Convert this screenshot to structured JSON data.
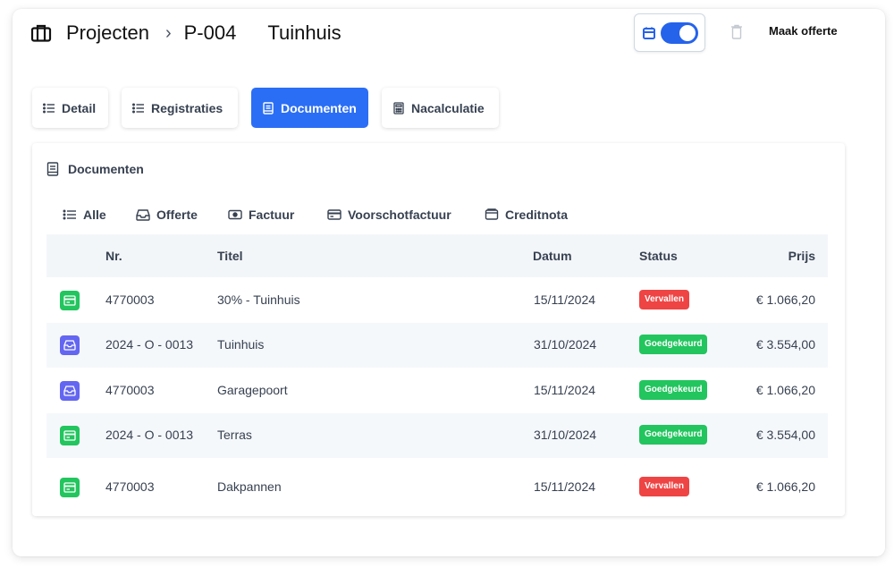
{
  "header": {
    "breadcrumb": "Projecten",
    "project_number": "P-004",
    "project_title": "Tuinhuis"
  },
  "actions": {
    "toggle_on": true,
    "make_quote_label": "Maak offerte"
  },
  "tabs": [
    {
      "label": "Detail",
      "icon": "list-icon",
      "active": false
    },
    {
      "label": "Registraties",
      "icon": "list-icon",
      "active": false
    },
    {
      "label": "Documenten",
      "icon": "document-icon",
      "active": true
    },
    {
      "label": "Nacalculatie",
      "icon": "calculator-icon",
      "active": false
    }
  ],
  "documents": {
    "title": "Documenten",
    "filters": [
      {
        "label": "Alle",
        "icon": "list-icon"
      },
      {
        "label": "Offerte",
        "icon": "inbox-icon"
      },
      {
        "label": "Factuur",
        "icon": "money-icon"
      },
      {
        "label": "Voorschotfactuur",
        "icon": "card-icon"
      },
      {
        "label": "Creditnota",
        "icon": "wallet-icon"
      }
    ],
    "columns": {
      "nr": "Nr.",
      "titel": "Titel",
      "datum": "Datum",
      "status": "Status",
      "prijs": "Prijs"
    },
    "rows": [
      {
        "type": "invoice",
        "nr": "4770003",
        "titel": "30% - Tuinhuis",
        "datum": "15/11/2024",
        "status": "Vervallen",
        "prijs": "€ 1.066,20"
      },
      {
        "type": "quote",
        "nr": "2024 - O - 0013",
        "titel": "Tuinhuis",
        "datum": "31/10/2024",
        "status": "Goedgekeurd",
        "prijs": "€ 3.554,00"
      },
      {
        "type": "quote",
        "nr": "4770003",
        "titel": "Garagepoort",
        "datum": "15/11/2024",
        "status": "Goedgekeurd",
        "prijs": "€ 1.066,20"
      },
      {
        "type": "invoice",
        "nr": "2024 - O - 0013",
        "titel": "Terras",
        "datum": "31/10/2024",
        "status": "Goedgekeurd",
        "prijs": "€ 3.554,00"
      },
      {
        "type": "invoice",
        "nr": "4770003",
        "titel": "Dakpannen",
        "datum": "15/11/2024",
        "status": "Vervallen",
        "prijs": "€ 1.066,20"
      }
    ]
  },
  "colors": {
    "accent": "#2b6ef6",
    "invoice_icon": "#22c55e",
    "quote_icon": "#6366f1",
    "status_overdue": "#ef4444",
    "status_approved": "#22c55e"
  }
}
